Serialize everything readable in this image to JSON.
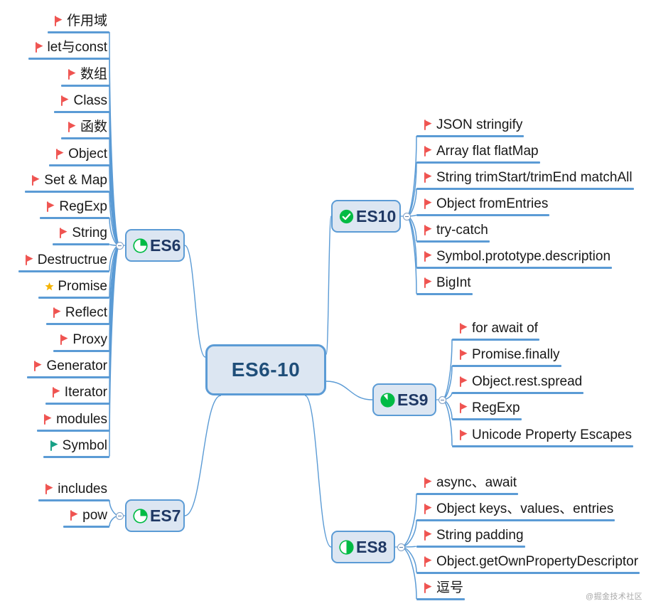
{
  "map": {
    "root": {
      "label": "ES6-10"
    },
    "watermark": "@掘金技术社区",
    "colors": {
      "node_fill": "#dce6f2",
      "node_border": "#5b9bd5",
      "root_text": "#1f4e79",
      "node_text": "#1f3864",
      "branch_line": "#5b9bd5",
      "flag_red": "#ef5350",
      "flag_teal": "#16a085",
      "star_gold": "#f5b301",
      "icon_green": "#00bb44",
      "leaf_text": "#181818"
    },
    "branches": [
      {
        "id": "es6",
        "label": "ES6",
        "icon": "pie-three-quarters-icon",
        "side": "left",
        "items": [
          {
            "label": "作用域",
            "marker": "flag-red"
          },
          {
            "label": "let与const",
            "marker": "flag-red"
          },
          {
            "label": "数组",
            "marker": "flag-red"
          },
          {
            "label": "Class",
            "marker": "flag-red"
          },
          {
            "label": "函数",
            "marker": "flag-red"
          },
          {
            "label": "Object",
            "marker": "flag-red"
          },
          {
            "label": "Set & Map",
            "marker": "flag-red"
          },
          {
            "label": "RegExp",
            "marker": "flag-red"
          },
          {
            "label": "String",
            "marker": "flag-red"
          },
          {
            "label": "Destructrue",
            "marker": "flag-red"
          },
          {
            "label": "Promise",
            "marker": "star-gold"
          },
          {
            "label": "Reflect",
            "marker": "flag-red"
          },
          {
            "label": "Proxy",
            "marker": "flag-red"
          },
          {
            "label": "Generator",
            "marker": "flag-red"
          },
          {
            "label": "Iterator",
            "marker": "flag-red"
          },
          {
            "label": "modules",
            "marker": "flag-red"
          },
          {
            "label": "Symbol",
            "marker": "flag-teal"
          }
        ]
      },
      {
        "id": "es7",
        "label": "ES7",
        "icon": "pie-three-quarters-icon",
        "side": "left",
        "items": [
          {
            "label": "includes",
            "marker": "flag-red"
          },
          {
            "label": "pow",
            "marker": "flag-red"
          }
        ]
      },
      {
        "id": "es10",
        "label": "ES10",
        "icon": "check-circle-icon",
        "side": "right",
        "items": [
          {
            "label": "JSON stringify",
            "marker": "flag-red"
          },
          {
            "label": "Array flat flatMap",
            "marker": "flag-red"
          },
          {
            "label": "String trimStart/trimEnd matchAll",
            "marker": "flag-red"
          },
          {
            "label": "Object fromEntries",
            "marker": "flag-red"
          },
          {
            "label": "try-catch",
            "marker": "flag-red"
          },
          {
            "label": "Symbol.prototype.description",
            "marker": "flag-red"
          },
          {
            "label": "BigInt",
            "marker": "flag-red"
          }
        ]
      },
      {
        "id": "es9",
        "label": "ES9",
        "icon": "pie-nearly-full-icon",
        "side": "right",
        "items": [
          {
            "label": "for await of",
            "marker": "flag-red"
          },
          {
            "label": "Promise.finally",
            "marker": "flag-red"
          },
          {
            "label": "Object.rest.spread",
            "marker": "flag-red"
          },
          {
            "label": "RegExp",
            "marker": "flag-red"
          },
          {
            "label": "Unicode Property Escapes",
            "marker": "flag-red"
          }
        ]
      },
      {
        "id": "es8",
        "label": "ES8",
        "icon": "half-circle-icon",
        "side": "right",
        "items": [
          {
            "label": "async、await",
            "marker": "flag-red"
          },
          {
            "label": "Object keys、values、entries",
            "marker": "flag-red"
          },
          {
            "label": "String padding",
            "marker": "flag-red"
          },
          {
            "label": "Object.getOwnPropertyDescriptor",
            "marker": "flag-red"
          },
          {
            "label": "逗号",
            "marker": "flag-red"
          }
        ]
      }
    ]
  }
}
